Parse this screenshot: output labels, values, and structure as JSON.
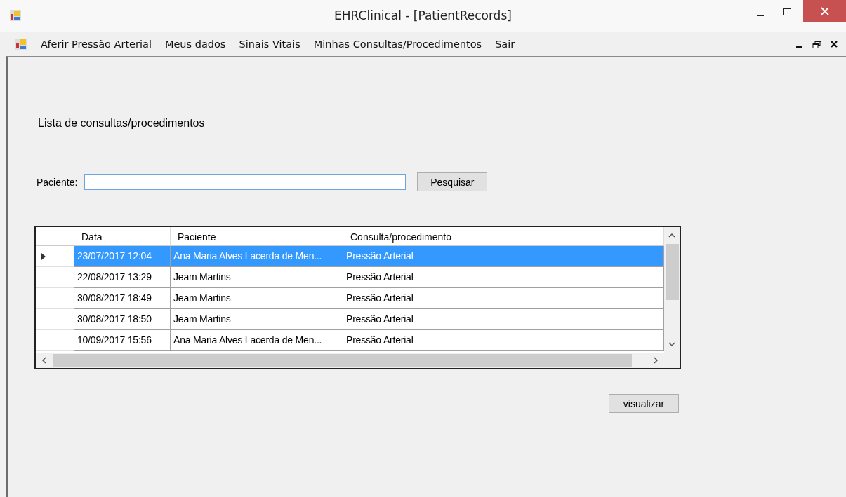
{
  "window": {
    "title": "EHRClinical - [PatientRecords]"
  },
  "menu": {
    "items": [
      "Aferir Pressão Arterial",
      "Meus dados",
      "Sinais Vitais",
      "Minhas Consultas/Procedimentos",
      "Sair"
    ]
  },
  "heading": "Lista de consultas/procedimentos",
  "search": {
    "label": "Paciente:",
    "button": "Pesquisar"
  },
  "table": {
    "columns": [
      "Data",
      "Paciente",
      "Consulta/procedimento"
    ],
    "rows": [
      {
        "cells": [
          "23/07/2017 12:04",
          "Ana Maria Alves Lacerda de Men...",
          "Pressão Arterial"
        ],
        "selected": true
      },
      {
        "cells": [
          "22/08/2017 13:29",
          "Jeam Martins",
          "Pressão Arterial"
        ],
        "selected": false
      },
      {
        "cells": [
          "30/08/2017 18:49",
          "Jeam Martins",
          "Pressão Arterial"
        ],
        "selected": false
      },
      {
        "cells": [
          "30/08/2017 18:50",
          "Jeam Martins",
          "Pressão Arterial"
        ],
        "selected": false
      },
      {
        "cells": [
          "10/09/2017 15:56",
          "Ana Maria Alves Lacerda de Men...",
          "Pressão Arterial"
        ],
        "selected": false
      }
    ]
  },
  "buttons": [
    "visualizar"
  ]
}
